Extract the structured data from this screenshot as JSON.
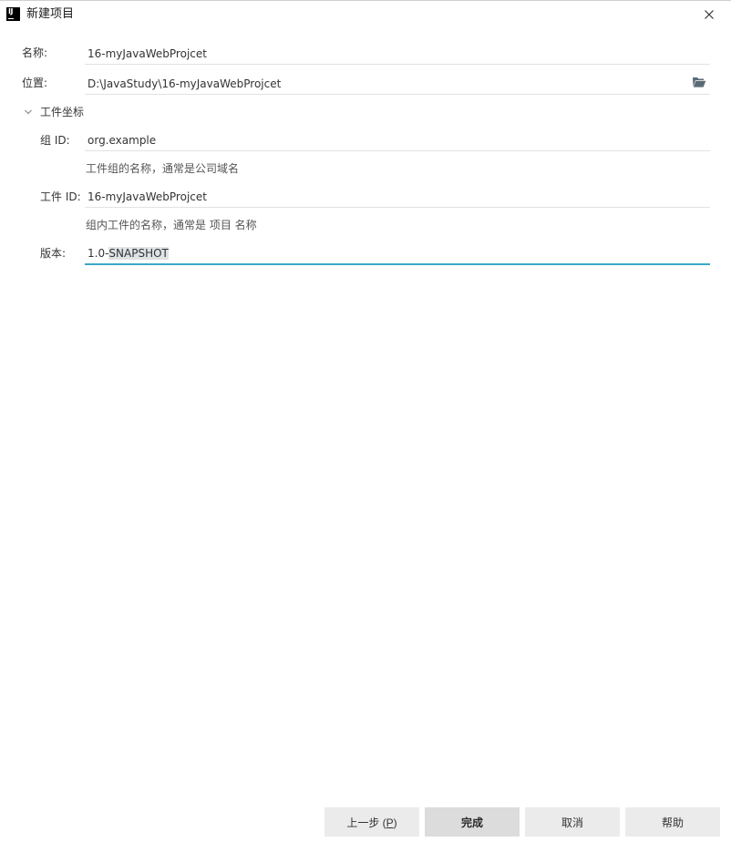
{
  "window": {
    "title": "新建项目",
    "logo_text": "IJ",
    "close_icon": "close-icon"
  },
  "form": {
    "name": {
      "label": "名称:",
      "value": "16-myJavaWebProjcet"
    },
    "location": {
      "label": "位置:",
      "value": "D:\\JavaStudy\\16-myJavaWebProjcet",
      "icon": "folder-open-icon"
    },
    "artifact_coordinates": {
      "section_label": "工件坐标",
      "expanded": true,
      "group_id": {
        "label": "组 ID:",
        "value": "org.example",
        "hint": "工件组的名称，通常是公司域名"
      },
      "artifact_id": {
        "label": "工件 ID:",
        "value": "16-myJavaWebProjcet",
        "hint": "组内工件的名称，通常是 项目 名称"
      },
      "version": {
        "label": "版本:",
        "value_prefix": "1.0-",
        "value_selected": "SNAPSHOT"
      }
    }
  },
  "footer": {
    "previous": {
      "label": "上一步 (",
      "mnemonic": "P",
      "label_end": ")"
    },
    "finish": "完成",
    "cancel": "取消",
    "help": "帮助"
  },
  "colors": {
    "focus_underline": "#3aa8c8",
    "selection": "#dfe3e6",
    "button_bg": "#ebebeb"
  }
}
